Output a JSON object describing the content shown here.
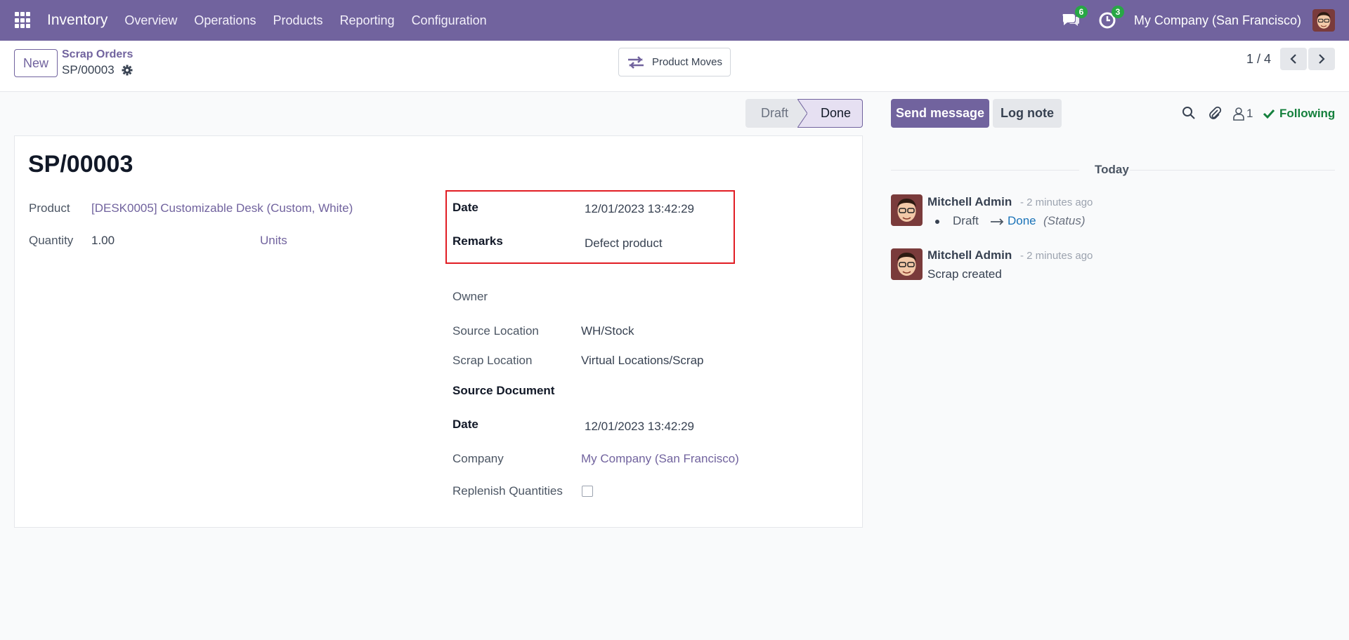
{
  "navbar": {
    "app_name": "Inventory",
    "menu": [
      "Overview",
      "Operations",
      "Products",
      "Reporting",
      "Configuration"
    ],
    "messages_count": "6",
    "activities_count": "3",
    "company": "My Company (San Francisco)"
  },
  "control_panel": {
    "new_label": "New",
    "breadcrumb_parent": "Scrap Orders",
    "breadcrumb_current": "SP/00003",
    "smart_button_label": "Product Moves",
    "pager_value": "1 / 4"
  },
  "statusbar": {
    "stages": [
      "Draft",
      "Done"
    ],
    "active": "Done"
  },
  "form": {
    "title": "SP/00003",
    "product_label": "Product",
    "product_value": "[DESK0005] Customizable Desk (Custom, White)",
    "quantity_label": "Quantity",
    "quantity_value": "1.00",
    "uom_value": "Units",
    "date_label": "Date",
    "date_value": "12/01/2023 13:42:29",
    "remarks_label": "Remarks",
    "remarks_value": "Defect product",
    "owner_label": "Owner",
    "source_location_label": "Source Location",
    "source_location_value": "WH/Stock",
    "scrap_location_label": "Scrap Location",
    "scrap_location_value": "Virtual Locations/Scrap",
    "source_document_label": "Source Document",
    "date2_label": "Date",
    "date2_value": "12/01/2023 13:42:29",
    "company_label": "Company",
    "company_value": "My Company (San Francisco)",
    "replenish_label": "Replenish Quantities"
  },
  "chatter": {
    "send_message_label": "Send message",
    "log_note_label": "Log note",
    "followers_count": "1",
    "following_label": "Following",
    "date_separator": "Today",
    "messages": [
      {
        "author": "Mitchell Admin",
        "time": "- 2 minutes ago",
        "tracking_from": "Draft",
        "tracking_to": "Done",
        "tracking_field": "(Status)"
      },
      {
        "author": "Mitchell Admin",
        "time": "- 2 minutes ago",
        "body": "Scrap created"
      }
    ]
  },
  "colors": {
    "brand": "#71639e",
    "following": "#15803d",
    "badge": "#28a745",
    "highlight_box": "#e11d24",
    "tracking_link": "#1a73b8"
  }
}
